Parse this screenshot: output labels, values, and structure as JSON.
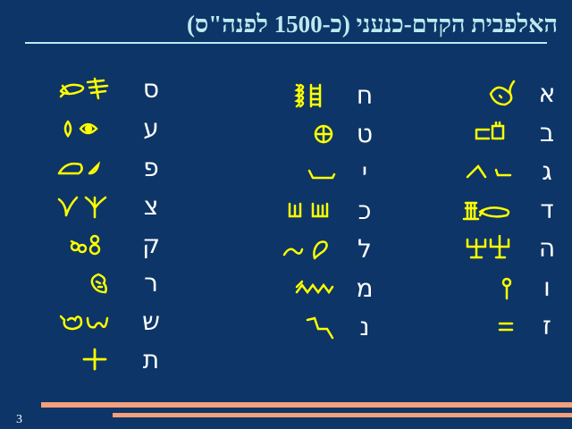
{
  "slide": {
    "title": "האלפבית הקדם-כנעני (כ-1500 לפנה\"ס)",
    "page_number": "3"
  },
  "columns": [
    {
      "letters": [
        "א",
        "ב",
        "ג",
        "ד",
        "ה",
        "ו",
        "ז"
      ]
    },
    {
      "letters": [
        "ח",
        "ט",
        "י",
        "כ",
        "ל",
        "מ",
        "נ"
      ]
    },
    {
      "letters": [
        "ס",
        "ע",
        "פ",
        "צ",
        "ק",
        "ר",
        "ש",
        "ת"
      ]
    }
  ],
  "colors": {
    "background": "#0d3567",
    "title": "#bfe9f0",
    "letter": "#ffffff",
    "glyph": "#ffff00",
    "accent_bar": "#f4a07a"
  },
  "glyph_icons": [
    [
      "ox-head-icon",
      "house-icon",
      "throw-stick-icon",
      "door-fish-icon",
      "praying-man-icon",
      "mace-icon",
      "double-line-icon"
    ],
    [
      "fence-icon",
      "cross-circle-icon",
      "hand-icon",
      "palm-icon",
      "goad-icon",
      "water-icon",
      "snake-icon"
    ],
    [
      "fish-pillar-icon",
      "eye-icon",
      "mouth-icon",
      "plant-icon",
      "monkey-icon",
      "head-icon",
      "tooth-icon",
      "cross-mark-icon"
    ]
  ]
}
